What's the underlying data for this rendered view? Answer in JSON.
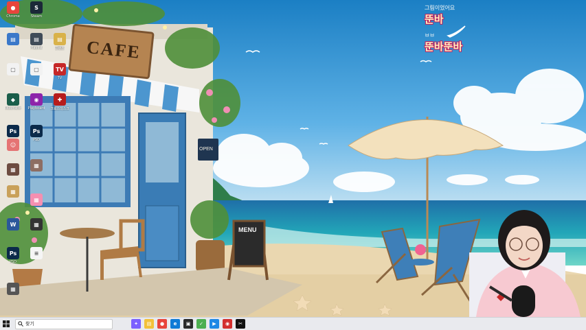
{
  "wallpaper": {
    "cafe_sign": "CAFE",
    "open_sign": "OPEN",
    "menu_board": "MENU"
  },
  "overlay": {
    "line1_small": "그림이었어요",
    "line1_big": "뚠바",
    "line2_small": "ㅂㅂ",
    "line2_big": "뚠바뚠바"
  },
  "desktop_icons": [
    {
      "name": "chrome",
      "label": "Chrome",
      "color": "#e8453c",
      "glyph": "●"
    },
    {
      "name": "steam",
      "label": "Steam",
      "color": "#1b2838",
      "glyph": "S"
    },
    {
      "name": "folder-1",
      "label": "",
      "color": "#3b78c9",
      "glyph": "▤"
    },
    {
      "name": "folder-2",
      "label": "Playlist",
      "color": "#404b58",
      "glyph": "▤"
    },
    {
      "name": "folder-3",
      "label": "콘텐츠",
      "color": "#d9b24a",
      "glyph": "▤"
    },
    {
      "name": "doc-1",
      "label": "",
      "color": "#f2f2f2",
      "glyph": "▢"
    },
    {
      "name": "doc-2",
      "label": "",
      "color": "#f2f2f2",
      "glyph": "▢"
    },
    {
      "name": "tv",
      "label": "TV",
      "color": "#c62828",
      "glyph": "TV"
    },
    {
      "name": "app-1",
      "label": "Illustrator",
      "color": "#1a5e4a",
      "glyph": "◆"
    },
    {
      "name": "app-2",
      "label": "Playboard",
      "color": "#8e24aa",
      "glyph": "◉"
    },
    {
      "name": "app-3",
      "label": "크로스데스크",
      "color": "#b71c1c",
      "glyph": "✚"
    },
    {
      "name": "photoshop-1",
      "label": "PSD",
      "color": "#0b2a4a",
      "glyph": "Ps"
    },
    {
      "name": "photoshop-2",
      "label": "PSD",
      "color": "#0b2a4a",
      "glyph": "Ps"
    },
    {
      "name": "avatar-1",
      "label": "",
      "color": "#e57373",
      "glyph": "☺"
    },
    {
      "name": "image-1",
      "label": "",
      "color": "#8d6e63",
      "glyph": "▦"
    },
    {
      "name": "image-2",
      "label": "",
      "color": "#6d4c41",
      "glyph": "▦"
    },
    {
      "name": "image-3",
      "label": "",
      "color": "#c9a15a",
      "glyph": "▦"
    },
    {
      "name": "image-4",
      "label": "",
      "color": "#f48fb1",
      "glyph": "▦"
    },
    {
      "name": "word",
      "label": "",
      "color": "#2b579a",
      "glyph": "W"
    },
    {
      "name": "image-5",
      "label": "",
      "color": "#333333",
      "glyph": "▦"
    },
    {
      "name": "photoshop-3",
      "label": "PSD",
      "color": "#0b2a4a",
      "glyph": "Ps"
    },
    {
      "name": "text-file",
      "label": "",
      "color": "#f5f5f5",
      "glyph": "≡"
    },
    {
      "name": "image-6",
      "label": "",
      "color": "#555555",
      "glyph": "▦"
    }
  ],
  "taskbar": {
    "search_placeholder": "찾기",
    "apps": [
      {
        "name": "copilot",
        "color": "#7b61ff",
        "glyph": "✦"
      },
      {
        "name": "file-explorer",
        "color": "#f3c13a",
        "glyph": "▤"
      },
      {
        "name": "chrome",
        "color": "#e8453c",
        "glyph": "●"
      },
      {
        "name": "edge",
        "color": "#0f7bd6",
        "glyph": "e"
      },
      {
        "name": "app-dark",
        "color": "#2a2a2a",
        "glyph": "▣"
      },
      {
        "name": "app-green",
        "color": "#4caf50",
        "glyph": "✓"
      },
      {
        "name": "app-blue",
        "color": "#1e88e5",
        "glyph": "▶"
      },
      {
        "name": "app-red",
        "color": "#d32f2f",
        "glyph": "◉"
      },
      {
        "name": "capcut",
        "color": "#111111",
        "glyph": "✂"
      }
    ]
  }
}
